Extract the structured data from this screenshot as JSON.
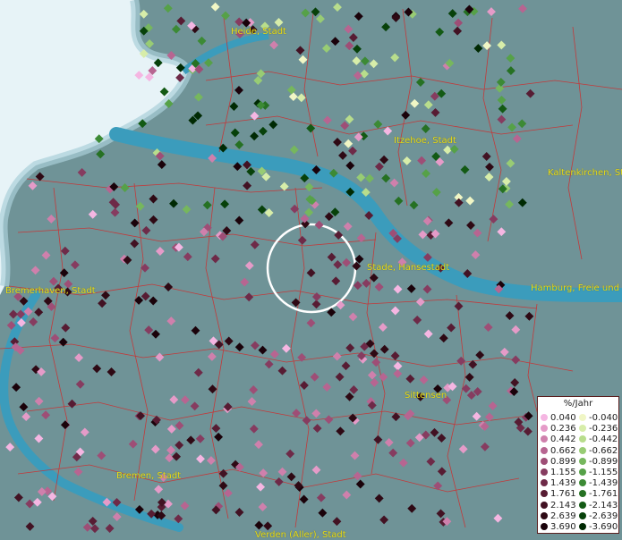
{
  "map": {
    "cities": [
      {
        "id": "heide",
        "label": "Heide, Stadt"
      },
      {
        "id": "itzehoe",
        "label": "Itzehoe, Stadt"
      },
      {
        "id": "kaltenkirchen",
        "label": "Kaltenkirchen, St"
      },
      {
        "id": "stade",
        "label": "Stade, Hansestadt"
      },
      {
        "id": "hamburg",
        "label": "Hamburg, Freie und"
      },
      {
        "id": "bremerhaven",
        "label": "Bremerhaven, Stadt"
      },
      {
        "id": "sittensen",
        "label": "Sittensen"
      },
      {
        "id": "bremen",
        "label": "Bremen, Stadt"
      },
      {
        "id": "verden",
        "label": "Verden (Aller), Stadt"
      }
    ],
    "colors": {
      "sea": "#e7f3f7",
      "land": "#6f9397",
      "river": "#3b9cbc",
      "borders": "#d12a2a",
      "labels": "#e8dc1a"
    }
  },
  "legend": {
    "title": "%/Jahr",
    "positive": [
      {
        "label": "0.040",
        "color": "#f5b6e2"
      },
      {
        "label": "0.236",
        "color": "#e59bc8"
      },
      {
        "label": "0.442",
        "color": "#cf80ac"
      },
      {
        "label": "0.662",
        "color": "#b76591"
      },
      {
        "label": "0.899",
        "color": "#9e4e76"
      },
      {
        "label": "1.155",
        "color": "#863c60"
      },
      {
        "label": "1.439",
        "color": "#6e2a48"
      },
      {
        "label": "1.761",
        "color": "#571c33"
      },
      {
        "label": "2.143",
        "color": "#421223"
      },
      {
        "label": "2.639",
        "color": "#2e0914"
      },
      {
        "label": "3.690",
        "color": "#1a020a"
      }
    ],
    "negative": [
      {
        "label": "-0.040",
        "color": "#f0f6c5"
      },
      {
        "label": "-0.236",
        "color": "#d7eda9"
      },
      {
        "label": "-0.442",
        "color": "#b8dd8c"
      },
      {
        "label": "-0.662",
        "color": "#98cc74"
      },
      {
        "label": "-0.899",
        "color": "#76b75d"
      },
      {
        "label": "-1.155",
        "color": "#56a148"
      },
      {
        "label": "-1.439",
        "color": "#3c8a35"
      },
      {
        "label": "-1.761",
        "color": "#267123"
      },
      {
        "label": "-2.143",
        "color": "#135a14"
      },
      {
        "label": "-2.639",
        "color": "#07410a"
      },
      {
        "label": "-3.690",
        "color": "#002a03"
      }
    ]
  }
}
